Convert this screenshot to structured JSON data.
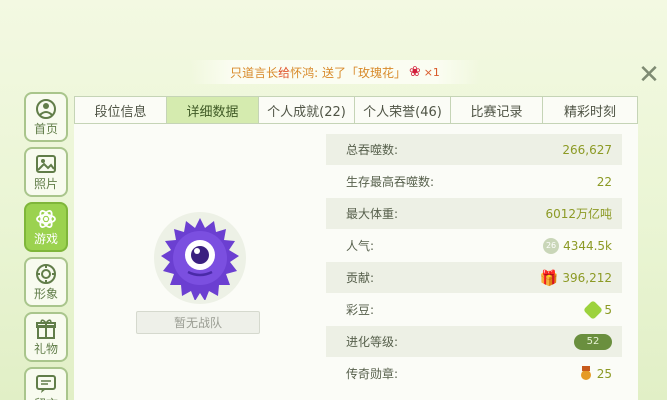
{
  "notice": {
    "sender": "只道言长",
    "verb": "给",
    "receiver": "怀鸿",
    "action": ": 送了「玫瑰花」",
    "count": "×1",
    "gift_icon": "rose-icon"
  },
  "sidebar": {
    "items": [
      {
        "label": "首页",
        "icon": "home-icon"
      },
      {
        "label": "照片",
        "icon": "photo-icon"
      },
      {
        "label": "游戏",
        "icon": "atom-icon",
        "active": true
      },
      {
        "label": "形象",
        "icon": "flower-icon"
      },
      {
        "label": "礼物",
        "icon": "gift-icon"
      },
      {
        "label": "留言",
        "icon": "message-icon"
      }
    ]
  },
  "tabs": [
    {
      "label": "段位信息"
    },
    {
      "label": "详细数据",
      "active": true
    },
    {
      "label": "个人成就(22)"
    },
    {
      "label": "个人荣誉(46)"
    },
    {
      "label": "比赛记录"
    },
    {
      "label": "精彩时刻"
    }
  ],
  "team_button": "暂无战队",
  "stats": [
    {
      "label": "总吞噬数:",
      "value": "266,627"
    },
    {
      "label": "生存最高吞噬数:",
      "value": "22"
    },
    {
      "label": "最大体重:",
      "value": "6012万亿吨"
    },
    {
      "label": "人气:",
      "value": "4344.5k",
      "badge": "26"
    },
    {
      "label": "贡献:",
      "value": "396,212"
    },
    {
      "label": "彩豆:",
      "value": "5"
    },
    {
      "label": "进化等级:",
      "value": "",
      "badge": "52"
    },
    {
      "label": "传奇勋章:",
      "value": "25"
    }
  ],
  "colors": {
    "accent_green": "#9bd24f",
    "value_color": "#8c9a25",
    "notice_orange": "#d88a2a",
    "avatar_purple": "#6b3fd1"
  }
}
